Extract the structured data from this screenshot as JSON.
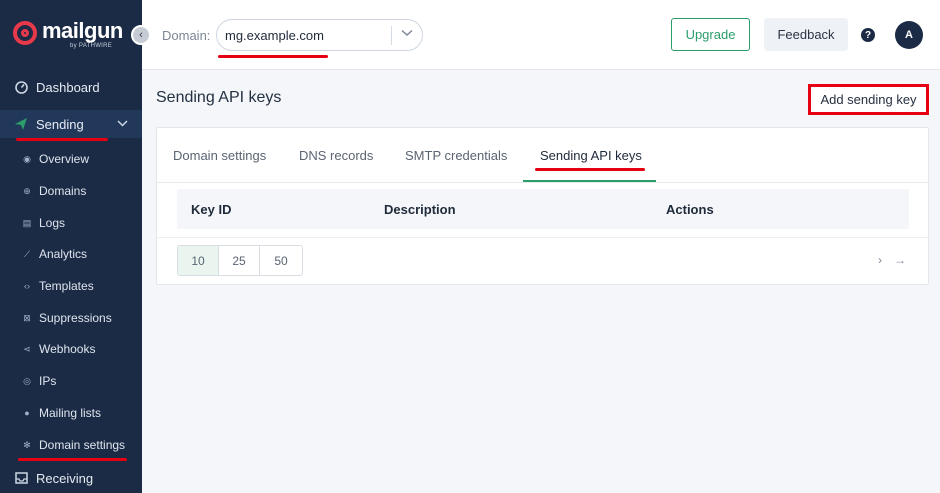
{
  "brand": {
    "name": "mailgun",
    "byline": "by PATHWIRE",
    "accent": "#e8394a",
    "sidebar_bg": "#1b2b45",
    "primary_green": "#2a9d6b"
  },
  "sidebar": {
    "collapse_glyph": "‹",
    "main_items": [
      {
        "label": "Dashboard",
        "icon": "dashboard-icon"
      },
      {
        "label": "Sending",
        "icon": "paper-plane-icon",
        "expanded": true
      },
      {
        "label": "Receiving",
        "icon": "inbox-icon"
      }
    ],
    "sub_items": [
      {
        "label": "Overview",
        "icon": "eye-icon"
      },
      {
        "label": "Domains",
        "icon": "globe-icon"
      },
      {
        "label": "Logs",
        "icon": "document-icon"
      },
      {
        "label": "Analytics",
        "icon": "chart-icon"
      },
      {
        "label": "Templates",
        "icon": "code-icon"
      },
      {
        "label": "Suppressions",
        "icon": "block-icon"
      },
      {
        "label": "Webhooks",
        "icon": "share-icon"
      },
      {
        "label": "IPs",
        "icon": "location-icon"
      },
      {
        "label": "Mailing lists",
        "icon": "person-icon"
      },
      {
        "label": "Domain settings",
        "icon": "gear-icon"
      }
    ]
  },
  "topbar": {
    "domain_label": "Domain:",
    "domain_value": "mg.example.com",
    "upgrade_label": "Upgrade",
    "feedback_label": "Feedback",
    "help_glyph": "?",
    "avatar_initial": "A"
  },
  "main": {
    "title": "Sending API keys",
    "add_key_label": "Add sending key",
    "tabs": [
      {
        "label": "Domain settings",
        "active": false
      },
      {
        "label": "DNS records",
        "active": false
      },
      {
        "label": "SMTP credentials",
        "active": false
      },
      {
        "label": "Sending API keys",
        "active": true
      }
    ],
    "table": {
      "columns": [
        "Key ID",
        "Description",
        "Actions"
      ],
      "rows": []
    },
    "page_sizes": [
      "10",
      "25",
      "50"
    ],
    "selected_page_size": "10",
    "next_glyph": "›",
    "last_glyph": "→"
  }
}
